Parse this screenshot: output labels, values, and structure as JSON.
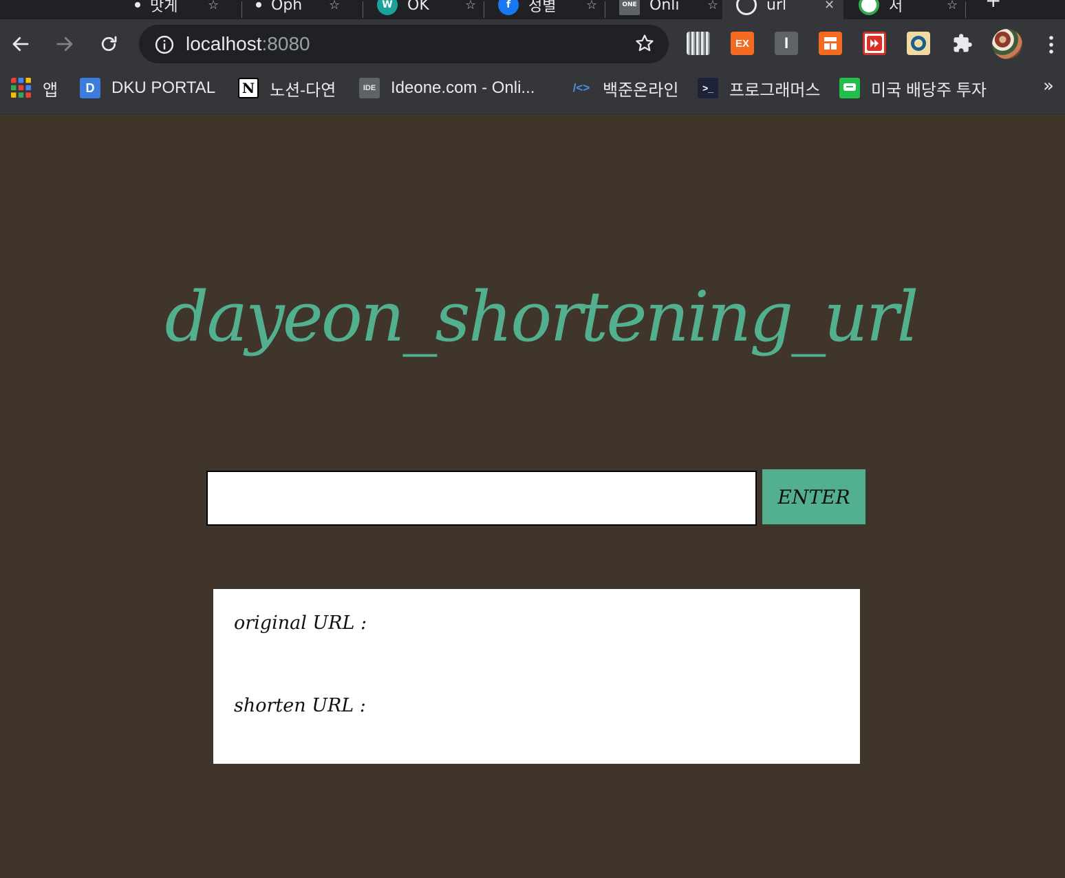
{
  "browser": {
    "tabs": [
      {
        "title": "맛게",
        "favicon": "dot-icon"
      },
      {
        "title": "Oph",
        "favicon": "dot-icon"
      },
      {
        "title": "OK",
        "favicon": "teal-circle-icon"
      },
      {
        "title": "성별",
        "favicon": "facebook-icon"
      },
      {
        "title": "Onli",
        "favicon": "ideone-icon"
      },
      {
        "title": "url",
        "favicon": "chrome-icon",
        "active": true
      },
      {
        "title": "서",
        "favicon": "green-ring-icon"
      }
    ],
    "new_tab_label": "+",
    "address": {
      "host": "localhost",
      "port": ":8080"
    },
    "extensions": [
      {
        "name": "barcode-extension-icon",
        "label": "",
        "color": "#9aa0a6"
      },
      {
        "name": "ex-extension-icon",
        "label": "EX",
        "color": "#f26b21"
      },
      {
        "name": "i-extension-icon",
        "label": "I",
        "color": "#5f6368"
      },
      {
        "name": "layout-extension-icon",
        "label": "",
        "color": "#f26b21"
      },
      {
        "name": "fast-forward-extension-icon",
        "label": "",
        "color": "#d93025"
      },
      {
        "name": "translate-extension-icon",
        "label": "",
        "color": "#f3d9a4"
      },
      {
        "name": "puzzle-extensions-icon",
        "label": "",
        "color": "#e8eaed"
      }
    ],
    "bookmarks": [
      {
        "label": "앱",
        "icon": "apps-grid-icon"
      },
      {
        "label": "DKU PORTAL",
        "icon": "dku-portal-icon",
        "icon_text": "D"
      },
      {
        "label": "노션-다연",
        "icon": "notion-icon",
        "icon_text": "N"
      },
      {
        "label": "Ideone.com - Onli...",
        "icon": "ideone-icon",
        "icon_text": "IDE"
      },
      {
        "label": "백준온라인",
        "icon": "code-brackets-icon",
        "icon_text": "/<>"
      },
      {
        "label": "프로그래머스",
        "icon": "programmers-icon",
        "icon_text": ">_"
      },
      {
        "label": "미국 배당주 투자",
        "icon": "line-chat-icon",
        "icon_text": ""
      }
    ],
    "bookmarks_overflow": "»"
  },
  "page": {
    "title": "dayeon_shortening_url",
    "input": {
      "value": "",
      "placeholder": ""
    },
    "enter_button": "ENTER",
    "result": {
      "original_label": "original URL :",
      "shorten_label": "shorten URL :"
    }
  },
  "colors": {
    "page_background": "#3f352b",
    "accent": "#52b08f",
    "browser_toolbar": "#35363a",
    "browser_tabstrip": "#202124"
  }
}
